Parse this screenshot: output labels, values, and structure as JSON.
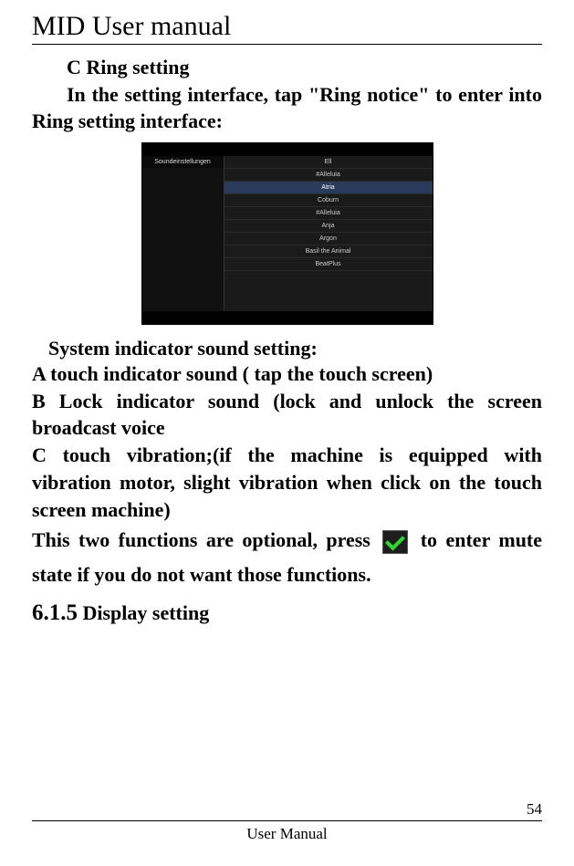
{
  "header": {
    "title": "MID User manual"
  },
  "section": {
    "heading": "C    Ring setting",
    "intro": "In the setting interface, tap \"Ring notice\" to enter into Ring setting interface:"
  },
  "screenshot": {
    "sidebar_title": "Soundeinstellungen",
    "rows": [
      "Ell",
      "#Alleluia",
      "Atria",
      "Coburn",
      "#Alleluia",
      "Anja",
      "Argon",
      "Basil the Animal",
      "BeatPlus"
    ]
  },
  "content": {
    "sub_heading": "System indicator sound setting:",
    "item_a": "A touch indicator sound ( tap the touch screen)",
    "item_b": "B Lock indicator sound (lock and unlock the screen broadcast voice",
    "item_c": "C touch vibration;(if the machine is equipped with vibration motor, slight vibration when click on the touch screen machine)",
    "icon_line_before": "This two functions are optional, press",
    "icon_line_after": "to enter mute state if you do not want those functions."
  },
  "display": {
    "number": "6.1.5",
    "label": "Display setting"
  },
  "footer": {
    "page_number": "54",
    "label": "User Manual"
  }
}
